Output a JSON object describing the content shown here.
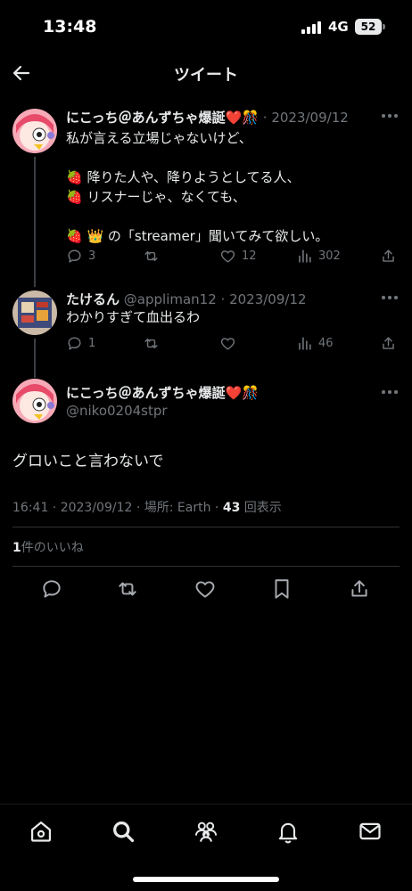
{
  "status_bar": {
    "time": "13:48",
    "network": "4G",
    "battery": "52"
  },
  "header": {
    "title": "ツイート"
  },
  "thread": [
    {
      "name": "にこっち＠あんずちゃ爆誕❤️🎊",
      "handle": "",
      "date": "· 2023/09/12",
      "text": "私が言える立場じゃないけど、\n\n🍓 降りた人や、降りようとしてる人、\n🍓 リスナーじゃ、なくても、\n\n🍓 👑 の「streamer」聞いてみて欲しい。",
      "replies": "3",
      "retweets": "",
      "likes": "12",
      "views": "302"
    },
    {
      "name": "たけるん",
      "handle": "@appliman12",
      "date": "· 2023/09/12",
      "text": "わかりすぎて血出るわ",
      "replies": "1",
      "retweets": "",
      "likes": "",
      "views": "46"
    }
  ],
  "main_tweet": {
    "name": "にこっち＠あんずちゃ爆誕❤️🎊",
    "handle": "@niko0204stpr",
    "text": "グロいこと言わないで",
    "time_date": "16:41 · 2023/09/12",
    "location": "場所: Earth",
    "views_count": "43",
    "views_label": "回表示",
    "likes_count": "1",
    "likes_label": "件のいいね"
  },
  "colors": {
    "background": "#000000",
    "text": "#e7e9ea",
    "muted": "#71767b",
    "divider": "#2f3336"
  },
  "icons": {
    "back": "arrow-left-icon",
    "reply": "speech-bubble-icon",
    "retweet": "retweet-icon",
    "like": "heart-icon",
    "views": "bar-chart-icon",
    "share": "share-icon",
    "bookmark": "bookmark-icon",
    "tabs": [
      "home-icon",
      "search-icon",
      "communities-icon",
      "bell-icon",
      "mail-icon"
    ]
  }
}
